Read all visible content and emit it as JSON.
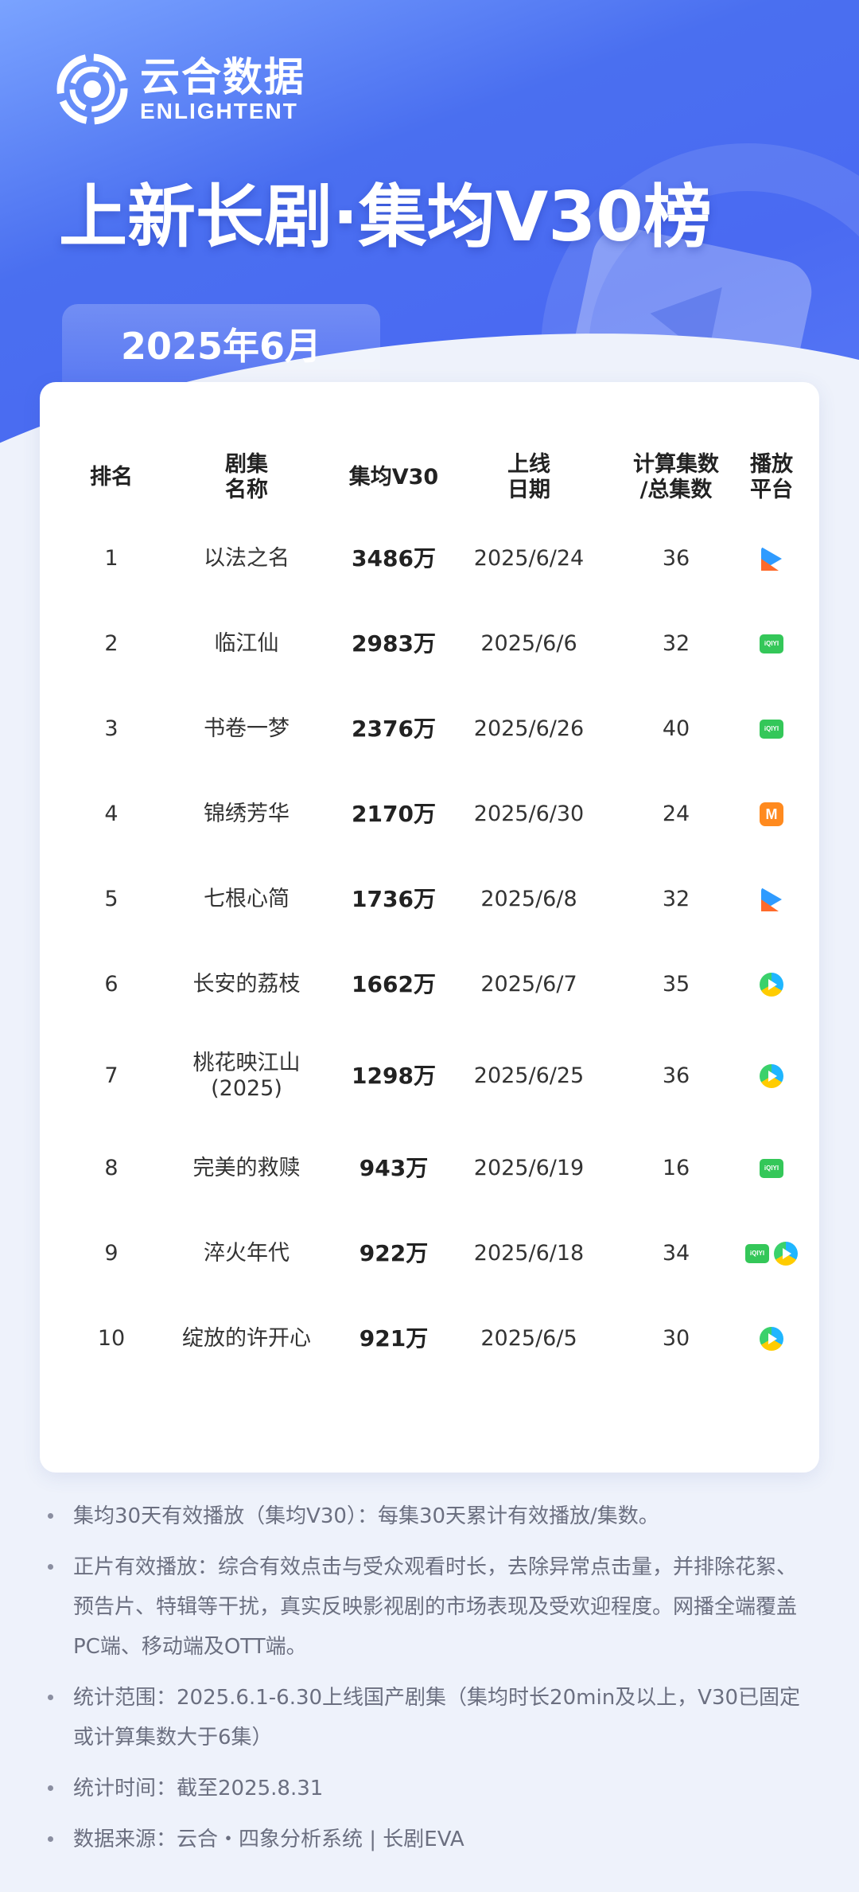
{
  "header": {
    "logo_cn": "云合数据",
    "logo_en": "ENLIGHTENT",
    "title": "上新长剧·集均V30榜",
    "period": "2025年6月"
  },
  "table": {
    "columns": [
      [
        "排名"
      ],
      [
        "剧集",
        "名称"
      ],
      [
        "集均V30"
      ],
      [
        "上线",
        "日期"
      ],
      [
        "计算集数",
        "/总集数"
      ],
      [
        "播放",
        "平台"
      ]
    ],
    "rows": [
      {
        "rank": "1",
        "name": [
          "以法之名"
        ],
        "v30": "3486万",
        "date": "2025/6/24",
        "episodes": "36",
        "platforms": [
          "youku-icon"
        ]
      },
      {
        "rank": "2",
        "name": [
          "临江仙"
        ],
        "v30": "2983万",
        "date": "2025/6/6",
        "episodes": "32",
        "platforms": [
          "iqiyi-icon"
        ]
      },
      {
        "rank": "3",
        "name": [
          "书卷一梦"
        ],
        "v30": "2376万",
        "date": "2025/6/26",
        "episodes": "40",
        "platforms": [
          "iqiyi-icon"
        ]
      },
      {
        "rank": "4",
        "name": [
          "锦绣芳华"
        ],
        "v30": "2170万",
        "date": "2025/6/30",
        "episodes": "24",
        "platforms": [
          "mango-icon"
        ]
      },
      {
        "rank": "5",
        "name": [
          "七根心简"
        ],
        "v30": "1736万",
        "date": "2025/6/8",
        "episodes": "32",
        "platforms": [
          "youku-icon"
        ]
      },
      {
        "rank": "6",
        "name": [
          "长安的荔枝"
        ],
        "v30": "1662万",
        "date": "2025/6/7",
        "episodes": "35",
        "platforms": [
          "tencent-video-icon"
        ]
      },
      {
        "rank": "7",
        "name": [
          "桃花映江山",
          "(2025)"
        ],
        "v30": "1298万",
        "date": "2025/6/25",
        "episodes": "36",
        "platforms": [
          "tencent-video-icon"
        ]
      },
      {
        "rank": "8",
        "name": [
          "完美的救赎"
        ],
        "v30": "943万",
        "date": "2025/6/19",
        "episodes": "16",
        "platforms": [
          "iqiyi-icon"
        ]
      },
      {
        "rank": "9",
        "name": [
          "淬火年代"
        ],
        "v30": "922万",
        "date": "2025/6/18",
        "episodes": "34",
        "platforms": [
          "iqiyi-icon",
          "tencent-video-icon"
        ]
      },
      {
        "rank": "10",
        "name": [
          "绽放的许开心"
        ],
        "v30": "921万",
        "date": "2025/6/5",
        "episodes": "30",
        "platforms": [
          "tencent-video-icon"
        ]
      }
    ]
  },
  "icons": {
    "iqiyi_label": "iQIYI",
    "mango_label": "M"
  },
  "notes": [
    "集均30天有效播放（集均V30）：每集30天累计有效播放/集数。",
    "正片有效播放：综合有效点击与受众观看时长，去除异常点击量，并排除花絮、预告片、特辑等干扰，真实反映影视剧的市场表现及受欢迎程度。网播全端覆盖PC端、移动端及OTT端。",
    "统计范围：2025.6.1-6.30上线国产剧集（集均时长20min及以上，V30已固定或计算集数大于6集）",
    "统计时间：截至2025.8.31",
    "数据来源：云合・四象分析系统 | 长剧EVA"
  ],
  "colors": {
    "brand_blue": "#4a6ff0",
    "page_bg": "#eef2fb",
    "iqiyi_green": "#34c759",
    "mango_orange": "#ff8a1f"
  }
}
